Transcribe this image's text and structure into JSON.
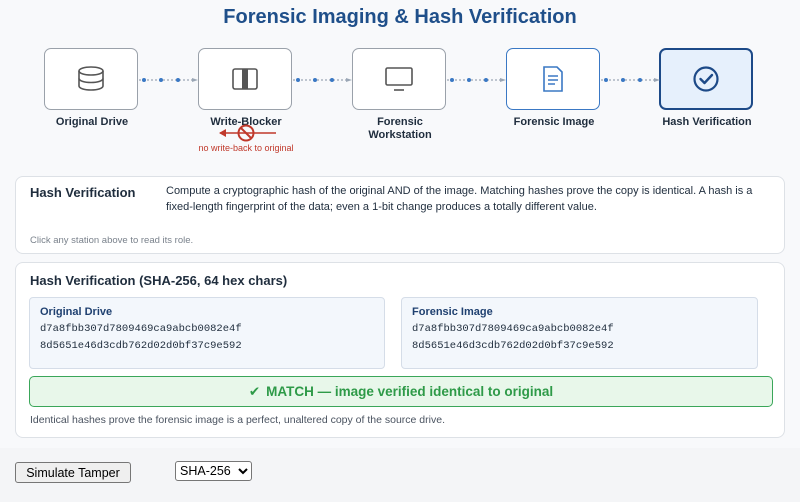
{
  "title": "Forensic Imaging & Hash Verification",
  "stations": [
    {
      "label": "Original Drive",
      "icon": "drive-icon"
    },
    {
      "label": "Write-Blocker",
      "icon": "write-blocker-icon"
    },
    {
      "label": "Forensic\nWorkstation",
      "icon": "monitor-icon"
    },
    {
      "label": "Forensic Image",
      "icon": "document-icon"
    },
    {
      "label": "Hash Verification",
      "icon": "check-circle-icon",
      "active": true
    }
  ],
  "write_blocker_note": "no write-back to original",
  "info": {
    "title": "Hash Verification",
    "description": "Compute a cryptographic hash of the original AND of the image. Matching hashes prove the copy is identical.  A hash is a fixed-length fingerprint of the data; even a 1-bit change produces a totally different value.",
    "hint": "Click any station above to read its role."
  },
  "hash_panel": {
    "title": "Hash Verification  (SHA-256, 64 hex chars)",
    "original": {
      "label": "Original Drive",
      "line1": "d7a8fbb307d7809469ca9abcb0082e4f",
      "line2": "8d5651e46d3cdb762d02d0bf37c9e592"
    },
    "image": {
      "label": "Forensic Image",
      "line1": "d7a8fbb307d7809469ca9abcb0082e4f",
      "line2": "8d5651e46d3cdb762d02d0bf37c9e592"
    },
    "match_text": "MATCH — image verified identical to original",
    "match_icon": "checkmark-icon",
    "footer": "Identical hashes prove the forensic image is a perfect, unaltered copy of the source drive."
  },
  "controls": {
    "tamper_label": "Simulate Tamper",
    "algorithm_selected": "SHA-256"
  },
  "colors": {
    "title": "#1f4f8a",
    "connector": "#3a78c4",
    "block": "#c0392b",
    "match_green": "#2e9a48",
    "active_border": "#1d4a88"
  }
}
